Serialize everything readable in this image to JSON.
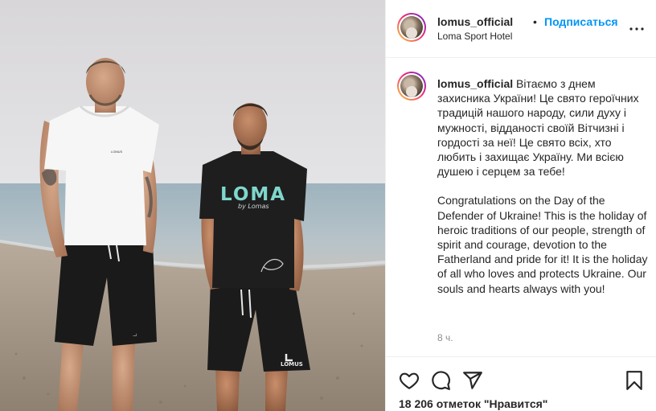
{
  "post": {
    "photo": {
      "shirt_logo_main": "LOMA",
      "shirt_logo_sub": "by Lomas",
      "shorts_logo": "LOMUS"
    },
    "header": {
      "username": "lomus_official",
      "separator": "•",
      "follow_label": "Подписаться",
      "location": "Loma Sport Hotel",
      "more_icon": "more-horizontal-icon"
    },
    "caption": {
      "username": "lomus_official",
      "text_ua": "Вітаємо з днем захисника України! Це свято героїчних традицій нашого народу, сили духу і мужності, відданості своїй Вітчизні і гордості за неї! Це свято всіх, хто любить і захищає Україну. Ми всією душею і серцем за тебе!",
      "text_en": "Congratulations on the Day of the Defender of Ukraine! This is the holiday of heroic traditions of our people, strength of spirit and courage, devotion to the Fatherland and pride for it! It is the holiday of all who loves and protects Ukraine. Our souls and hearts always with you!",
      "time": "8 ч."
    },
    "actions": {
      "like_icon": "heart-icon",
      "comment_icon": "comment-icon",
      "share_icon": "paper-plane-icon",
      "save_icon": "bookmark-icon",
      "likes_text": "18 206 отметок \"Нравится\""
    },
    "colors": {
      "link": "#0095f6",
      "text": "#262626",
      "muted": "#8e8e8e",
      "divider": "#efefef",
      "shirt_logo": "#7fd6cc"
    }
  }
}
